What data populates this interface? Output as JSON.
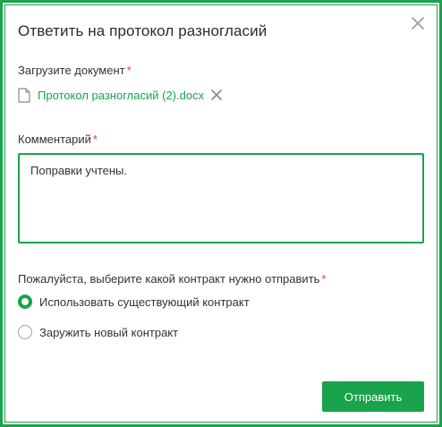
{
  "dialog": {
    "title": "Ответить на протокол разногласий"
  },
  "upload": {
    "label": "Загрузите документ",
    "required_mark": "*",
    "file_name": "Протокол разногласий (2).docx",
    "file_icon": "document-icon",
    "remove_icon": "close-icon"
  },
  "comment": {
    "label": "Комментарий",
    "required_mark": "*",
    "value": "Поправки учтены."
  },
  "contract_choice": {
    "label": "Пожалуйста, выберите какой контракт нужно отправить",
    "required_mark": "*",
    "options": [
      {
        "label": "Использовать существующий контракт",
        "selected": true
      },
      {
        "label": "Заружить новый контракт",
        "selected": false
      }
    ]
  },
  "actions": {
    "submit_label": "Отправить"
  },
  "colors": {
    "accent": "#19a34b",
    "required": "#e53935",
    "text": "#333333"
  }
}
